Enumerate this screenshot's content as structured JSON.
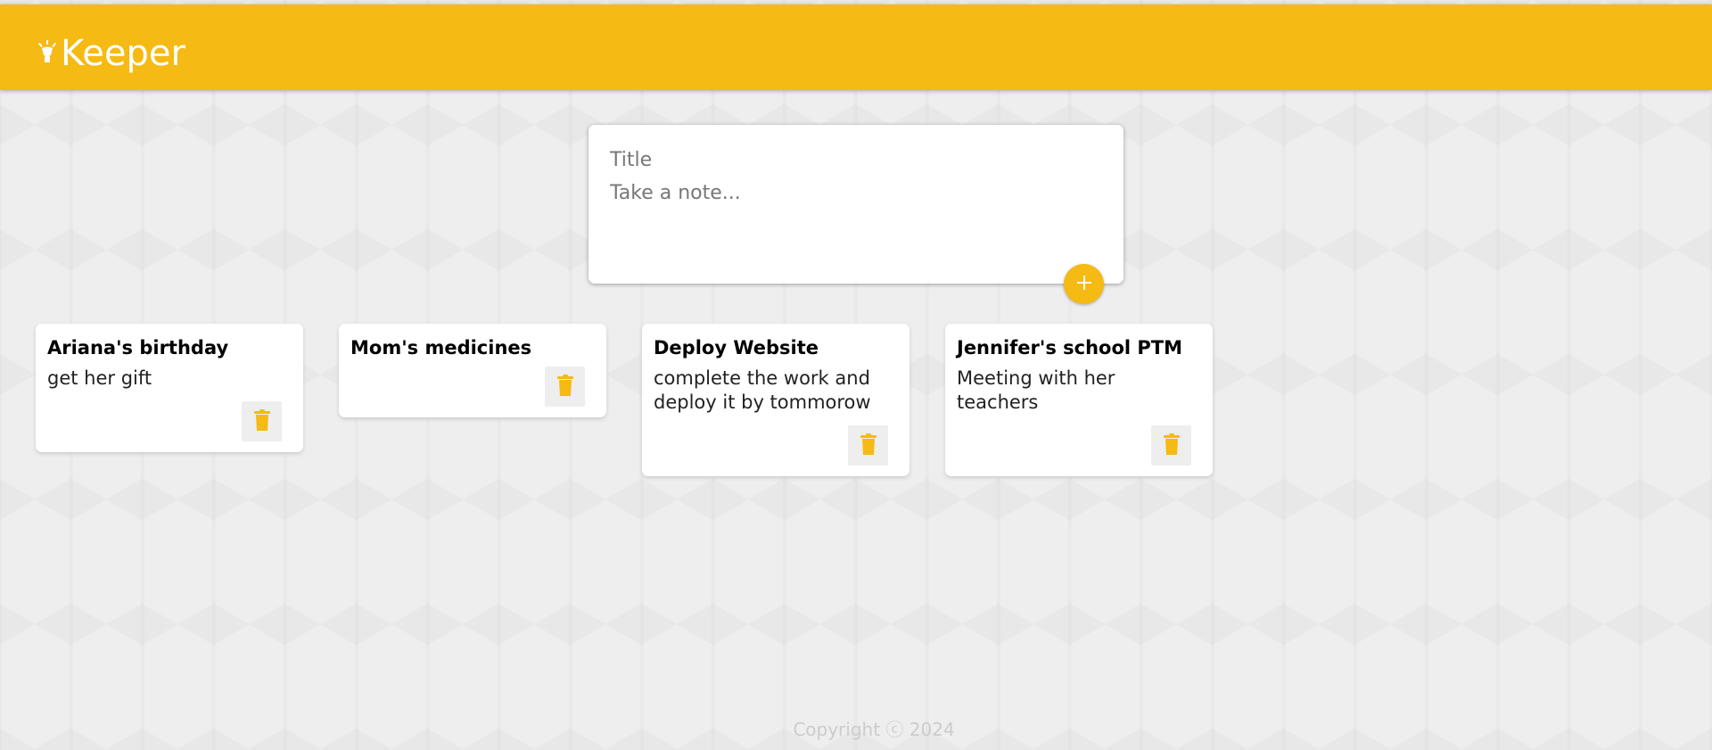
{
  "header": {
    "app_name": "Keeper",
    "logo_icon": "lightbulb-icon",
    "background_color": "#f5ba13"
  },
  "create_area": {
    "title_placeholder": "Title",
    "title_value": "",
    "note_placeholder": "Take a note...",
    "note_value": "",
    "add_icon": "plus-icon"
  },
  "notes": [
    {
      "title": "Ariana's birthday",
      "content": "get her gift",
      "delete_icon": "trash-icon"
    },
    {
      "title": "Mom's medicines",
      "content": "",
      "delete_icon": "trash-icon"
    },
    {
      "title": "Deploy Website",
      "content": "complete the work and deploy it by tommorow",
      "delete_icon": "trash-icon"
    },
    {
      "title": "Jennifer's school PTM",
      "content": "Meeting with her teachers",
      "delete_icon": "trash-icon"
    }
  ],
  "footer": {
    "copyright": "Copyright ⓒ 2024"
  },
  "colors": {
    "accent": "#f5ba13",
    "background": "#eeeeee",
    "card": "#ffffff"
  }
}
